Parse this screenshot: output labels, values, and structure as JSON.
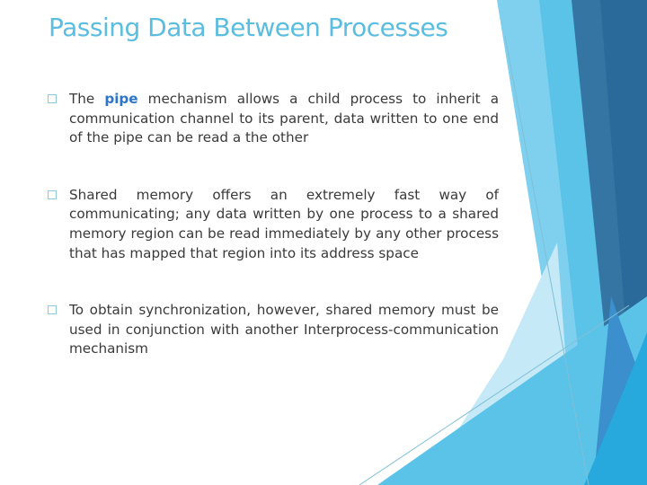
{
  "slide": {
    "title": "Passing Data Between Processes",
    "bullets": [
      {
        "before": "The ",
        "highlight": "pipe",
        "after": " mechanism allows a child process to inherit a communication channel to its parent, data written to one end of the pipe can be read a the other"
      },
      {
        "text": "Shared memory offers an extremely fast way of communicating; any data written by one process to a shared memory region can be read immediately by any other process that has mapped that region into its address space"
      },
      {
        "text": "To obtain synchronization, however, shared memory must be used in conjunction with another Interprocess-communication mechanism"
      }
    ],
    "bullet_icon": "hollow-square-icon"
  },
  "theme": {
    "title_color": "#5bbde0",
    "text_color": "#3a3a3a",
    "highlight_color": "#2e74c9",
    "facet_colors": {
      "deep_blue": "#2a6a9a",
      "steel_blue": "#3475a4",
      "light_sky": "#7fd0ef",
      "sky": "#5cc3e8",
      "pale_sky": "#c5e9f6",
      "cyan": "#27a9dd",
      "mid_blue": "#3a8fcc",
      "rule_line": "#7fbfd6"
    }
  }
}
